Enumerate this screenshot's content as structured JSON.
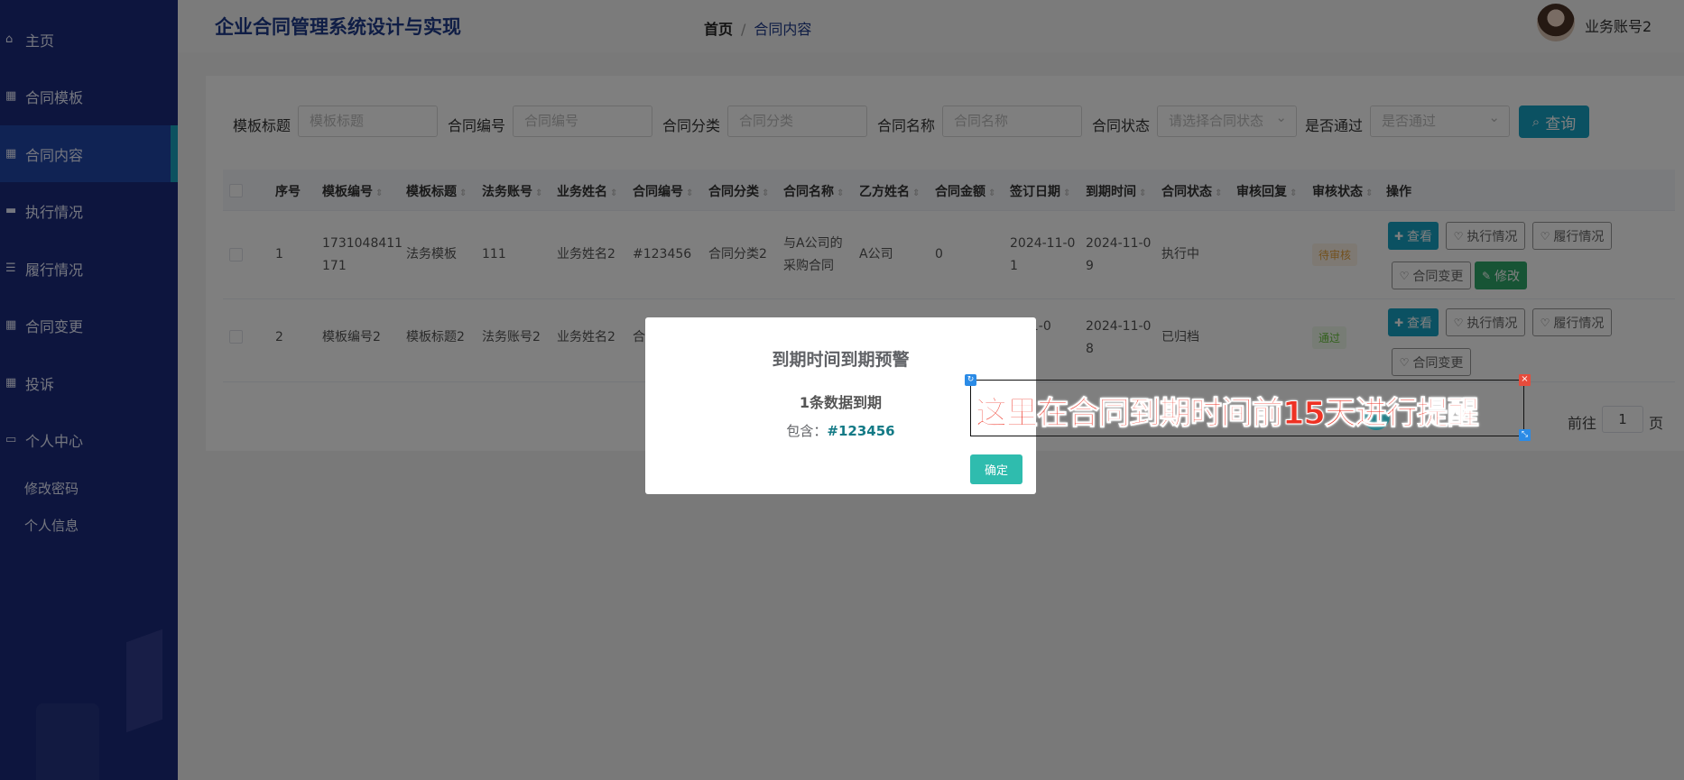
{
  "sidebar": {
    "items": [
      {
        "label": "主页",
        "icon": "home-icon"
      },
      {
        "label": "合同模板",
        "icon": "grid-icon"
      },
      {
        "label": "合同内容",
        "icon": "grid-icon"
      },
      {
        "label": "执行情况",
        "icon": "briefcase-icon"
      },
      {
        "label": "履行情况",
        "icon": "list-icon"
      },
      {
        "label": "合同变更",
        "icon": "grid-icon"
      },
      {
        "label": "投诉",
        "icon": "grid-icon"
      },
      {
        "label": "个人中心",
        "icon": "wallet-icon"
      }
    ],
    "submenu": [
      "修改密码",
      "个人信息"
    ]
  },
  "header": {
    "title": "企业合同管理系统设计与实现",
    "breadcrumb_home": "首页",
    "breadcrumb_sep": "/",
    "breadcrumb_current": "合同内容",
    "username": "业务账号2"
  },
  "filters": [
    {
      "label": "模板标题",
      "placeholder": "模板标题"
    },
    {
      "label": "合同编号",
      "placeholder": "合同编号"
    },
    {
      "label": "合同分类",
      "placeholder": "合同分类"
    },
    {
      "label": "合同名称",
      "placeholder": "合同名称"
    },
    {
      "label": "合同状态",
      "placeholder": "请选择合同状态"
    },
    {
      "label": "是否通过",
      "placeholder": "是否通过"
    }
  ],
  "query_button": "查询",
  "table": {
    "headers": [
      "序号",
      "模板编号",
      "模板标题",
      "法务账号",
      "业务姓名",
      "合同编号",
      "合同分类",
      "合同名称",
      "乙方姓名",
      "合同金额",
      "签订日期",
      "到期时间",
      "合同状态",
      "审核回复",
      "审核状态",
      "操作"
    ],
    "rows": [
      {
        "no": "1",
        "tpl_no_1": "1731048411",
        "tpl_no_2": "171",
        "tpl_title": "法务模板",
        "legal": "111",
        "biz": "业务姓名2",
        "contract_no": "#123456",
        "category": "合同分类2",
        "name_1": "与A公司的",
        "name_2": "采购合同",
        "party_b": "A公司",
        "amount": "0",
        "sign_1": "2024-11-0",
        "sign_2": "1",
        "due_1": "2024-11-0",
        "due_2": "9",
        "status": "执行中",
        "audit": "待审核"
      },
      {
        "no": "2",
        "tpl_no": "模板编号2",
        "tpl_title": "模板标题2",
        "legal": "法务账号2",
        "biz": "业务姓名2",
        "contract_no_partial": "合",
        "sign_1": "4-11-0",
        "due_1": "2024-11-0",
        "due_2": "8",
        "status": "已归档",
        "audit": "通过"
      }
    ],
    "actions": {
      "view": "查看",
      "exec": "执行情况",
      "perform": "履行情况",
      "change": "合同变更",
      "edit": "修改"
    }
  },
  "pager": {
    "goto": "前往",
    "page": "1",
    "unit": "页"
  },
  "dialog": {
    "title": "到期时间到期预警",
    "subtitle": "1条数据到期",
    "contains_label": "包含：",
    "contains_value": "#123456",
    "ok": "确定"
  },
  "annotation": {
    "text": "这里在合同到期时间前15天进行提醒"
  }
}
